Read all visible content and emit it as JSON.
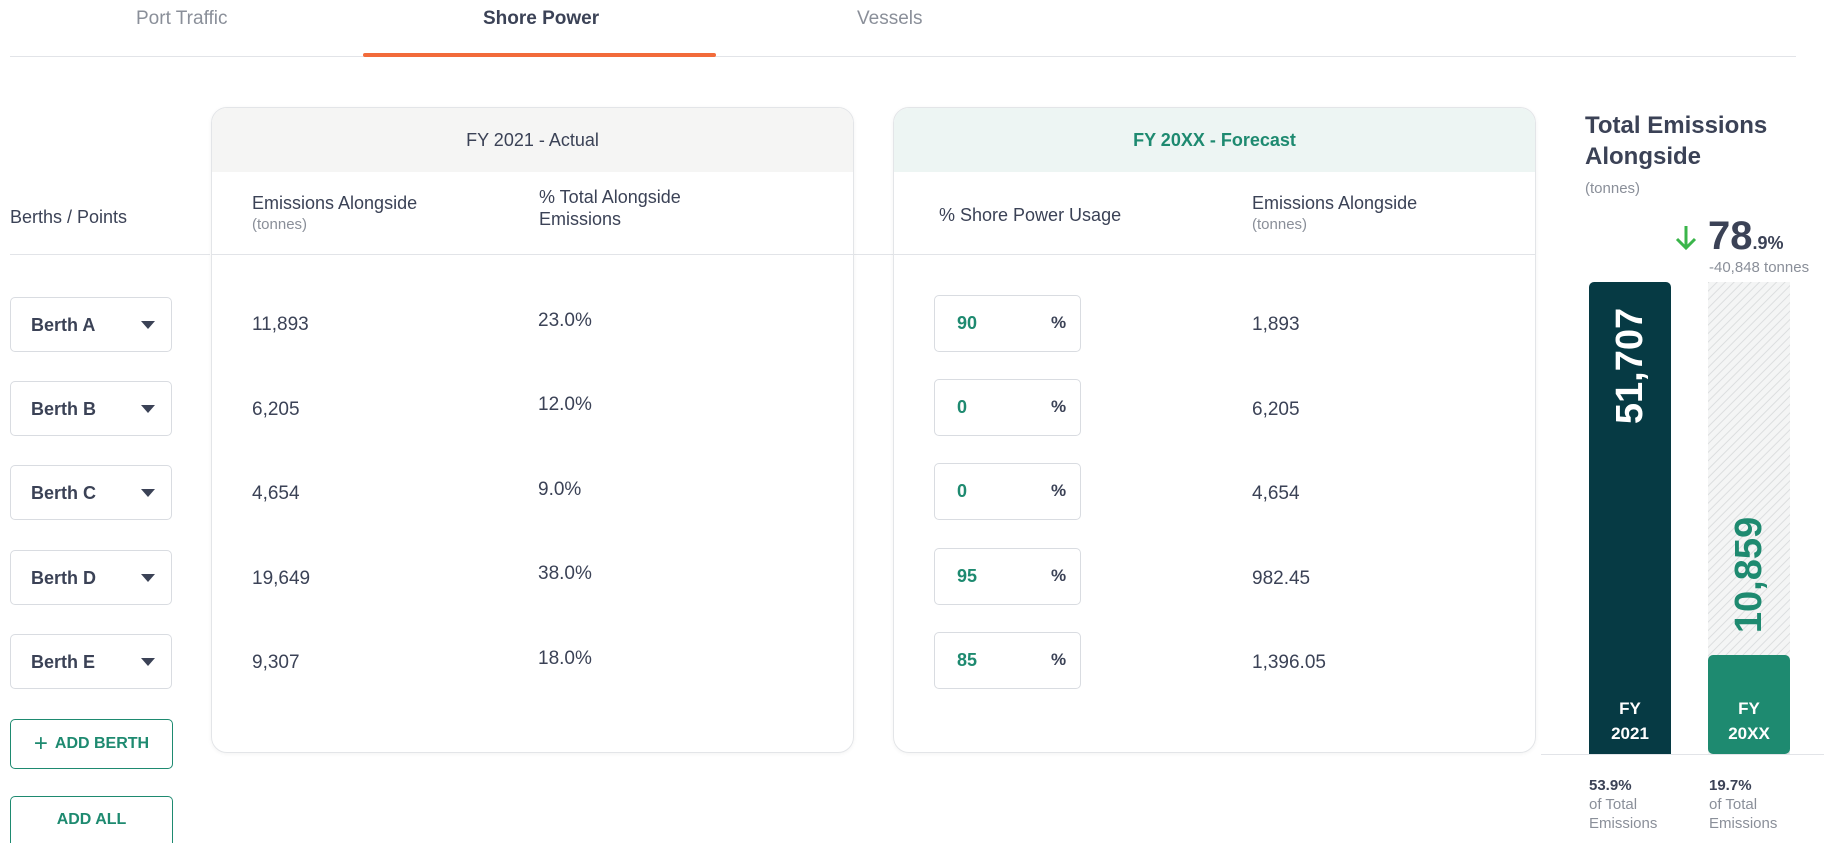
{
  "tabs": [
    {
      "label": "Port Traffic"
    },
    {
      "label": "Shore Power"
    },
    {
      "label": "Vessels"
    }
  ],
  "berths_label": "Berths / Points",
  "actual": {
    "title": "FY 2021 - Actual",
    "col1_title": "Emissions Alongside",
    "col1_unit": "(tonnes)",
    "col2_title_line1": "% Total Alongside",
    "col2_title_line2": "Emissions"
  },
  "forecast": {
    "title": "FY 20XX - Forecast",
    "col1_title": "% Shore Power Usage",
    "col2_title": "Emissions Alongside",
    "col2_unit": "(tonnes)"
  },
  "rows": [
    {
      "berth": "Berth A",
      "emissions": "11,893",
      "pct_total": "23.0%",
      "shore_power": "90",
      "pct_sign": "%",
      "forecast_emissions": "1,893"
    },
    {
      "berth": "Berth B",
      "emissions": "6,205",
      "pct_total": "12.0%",
      "shore_power": "0",
      "pct_sign": "%",
      "forecast_emissions": "6,205"
    },
    {
      "berth": "Berth C",
      "emissions": "4,654",
      "pct_total": "9.0%",
      "shore_power": "0",
      "pct_sign": "%",
      "forecast_emissions": "4,654"
    },
    {
      "berth": "Berth D",
      "emissions": "19,649",
      "pct_total": "38.0%",
      "shore_power": "95",
      "pct_sign": "%",
      "forecast_emissions": "982.45"
    },
    {
      "berth": "Berth E",
      "emissions": "9,307",
      "pct_total": "18.0%",
      "shore_power": "85",
      "pct_sign": "%",
      "forecast_emissions": "1,396.05"
    }
  ],
  "buttons": {
    "add_berth": "ADD BERTH",
    "add_all": "ADD ALL"
  },
  "summary": {
    "title_line1": "Total Emissions",
    "title_line2": "Alongside",
    "unit": "(tonnes)",
    "reduction_main": "78",
    "reduction_decimal": ".9%",
    "reduction_tonnes": "-40,848 tonnes",
    "bar_actual_value": "51,707",
    "bar_actual_label_line1": "FY",
    "bar_actual_label_line2": "2021",
    "bar_forecast_value": "10,859",
    "bar_forecast_label_line1": "FY",
    "bar_forecast_label_line2": "20XX",
    "forecast_fill_fraction": 0.21,
    "actual_pct": "53.9%",
    "actual_pct_sub_line1": "of Total",
    "actual_pct_sub_line2": "Emissions",
    "forecast_pct": "19.7%",
    "forecast_pct_sub_line1": "of Total",
    "forecast_pct_sub_line2": "Emissions"
  },
  "colors": {
    "accent_orange": "#f26b3a",
    "green": "#1e8a70",
    "dark_teal": "#063a44",
    "text": "#3b4256",
    "reduction_arrow": "#3ab54a"
  }
}
